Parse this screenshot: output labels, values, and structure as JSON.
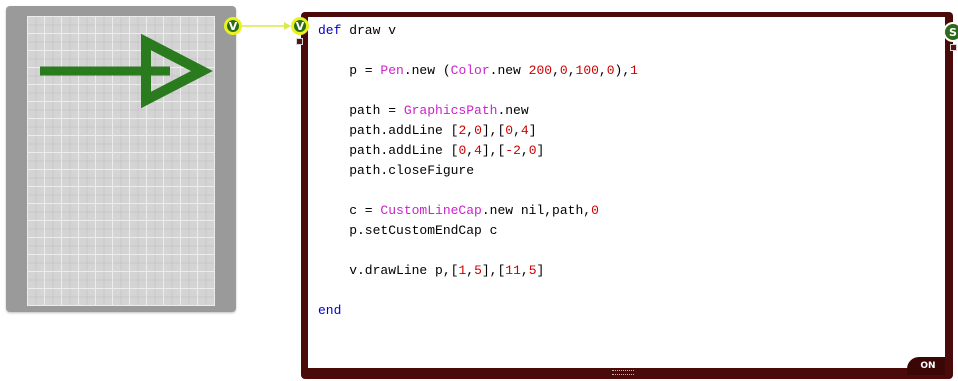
{
  "colors": {
    "panel_bg": "#9a9a9a",
    "grid_bg": "#d4d4d4",
    "arrow": "#2a7a1e",
    "node_frame": "#4a0a0a",
    "pin_fill": "#2d6b1a",
    "pin_ring": "#e8f21c",
    "keyword": "#0000cc",
    "class_name": "#cc22cc",
    "number": "#cc0000"
  },
  "viewport": {
    "drawing_icon": "arrow-right-icon"
  },
  "pins": {
    "view_output": "V",
    "code_input": "V",
    "code_output": "S"
  },
  "code": {
    "lines": [
      [
        {
          "t": "kw",
          "v": "def"
        },
        {
          "t": "txt",
          "v": " draw v"
        }
      ],
      [],
      [
        {
          "t": "txt",
          "v": "    p = "
        },
        {
          "t": "cls",
          "v": "Pen"
        },
        {
          "t": "txt",
          "v": ".new ("
        },
        {
          "t": "cls",
          "v": "Color"
        },
        {
          "t": "txt",
          "v": ".new "
        },
        {
          "t": "num",
          "v": "200"
        },
        {
          "t": "txt",
          "v": ","
        },
        {
          "t": "num",
          "v": "0"
        },
        {
          "t": "txt",
          "v": ","
        },
        {
          "t": "num",
          "v": "100"
        },
        {
          "t": "txt",
          "v": ","
        },
        {
          "t": "num",
          "v": "0"
        },
        {
          "t": "txt",
          "v": "),"
        },
        {
          "t": "num",
          "v": "1"
        }
      ],
      [],
      [
        {
          "t": "txt",
          "v": "    path = "
        },
        {
          "t": "cls",
          "v": "GraphicsPath"
        },
        {
          "t": "txt",
          "v": ".new"
        }
      ],
      [
        {
          "t": "txt",
          "v": "    path.addLine ["
        },
        {
          "t": "num",
          "v": "2"
        },
        {
          "t": "txt",
          "v": ","
        },
        {
          "t": "num",
          "v": "0"
        },
        {
          "t": "txt",
          "v": "],["
        },
        {
          "t": "num",
          "v": "0"
        },
        {
          "t": "txt",
          "v": ","
        },
        {
          "t": "num",
          "v": "4"
        },
        {
          "t": "txt",
          "v": "]"
        }
      ],
      [
        {
          "t": "txt",
          "v": "    path.addLine ["
        },
        {
          "t": "num",
          "v": "0"
        },
        {
          "t": "txt",
          "v": ","
        },
        {
          "t": "num",
          "v": "4"
        },
        {
          "t": "txt",
          "v": "],["
        },
        {
          "t": "num",
          "v": "-2"
        },
        {
          "t": "txt",
          "v": ","
        },
        {
          "t": "num",
          "v": "0"
        },
        {
          "t": "txt",
          "v": "]"
        }
      ],
      [
        {
          "t": "txt",
          "v": "    path.closeFigure"
        }
      ],
      [],
      [
        {
          "t": "txt",
          "v": "    c = "
        },
        {
          "t": "cls",
          "v": "CustomLineCap"
        },
        {
          "t": "txt",
          "v": ".new nil,path,"
        },
        {
          "t": "num",
          "v": "0"
        }
      ],
      [
        {
          "t": "txt",
          "v": "    p.setCustomEndCap c"
        }
      ],
      [],
      [
        {
          "t": "txt",
          "v": "    v.drawLine p,["
        },
        {
          "t": "num",
          "v": "1"
        },
        {
          "t": "txt",
          "v": ","
        },
        {
          "t": "num",
          "v": "5"
        },
        {
          "t": "txt",
          "v": "],["
        },
        {
          "t": "num",
          "v": "11"
        },
        {
          "t": "txt",
          "v": ","
        },
        {
          "t": "num",
          "v": "5"
        },
        {
          "t": "txt",
          "v": "]"
        }
      ],
      [],
      [
        {
          "t": "kw",
          "v": "end"
        }
      ]
    ]
  },
  "status": {
    "on_label": "ON"
  }
}
